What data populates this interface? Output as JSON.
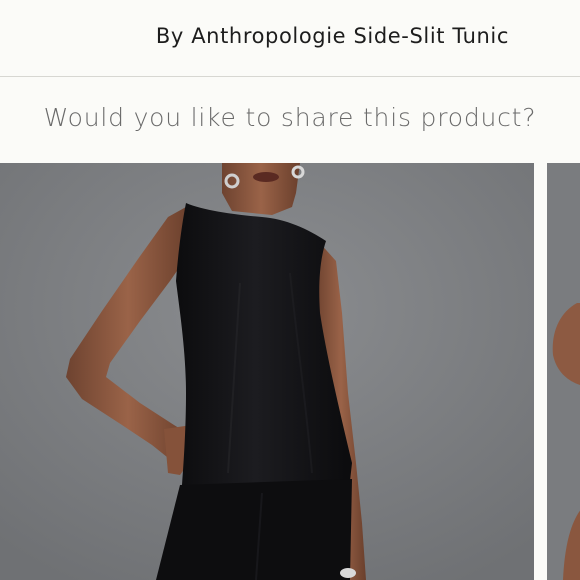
{
  "header": {
    "title": "By Anthropologie Side-Slit Tunic"
  },
  "share": {
    "prompt": "Would you like to share this product?"
  },
  "gallery": {
    "images": [
      {
        "icon": "product-photo-model-black-sleeveless-tunic"
      },
      {
        "icon": "product-photo-next-partial"
      }
    ]
  },
  "colors": {
    "background": "#fbfbf8",
    "photo_backdrop": "#7e8083",
    "garment": "#121214",
    "skin": "#8a5840",
    "divider": "#d7d7d2"
  }
}
